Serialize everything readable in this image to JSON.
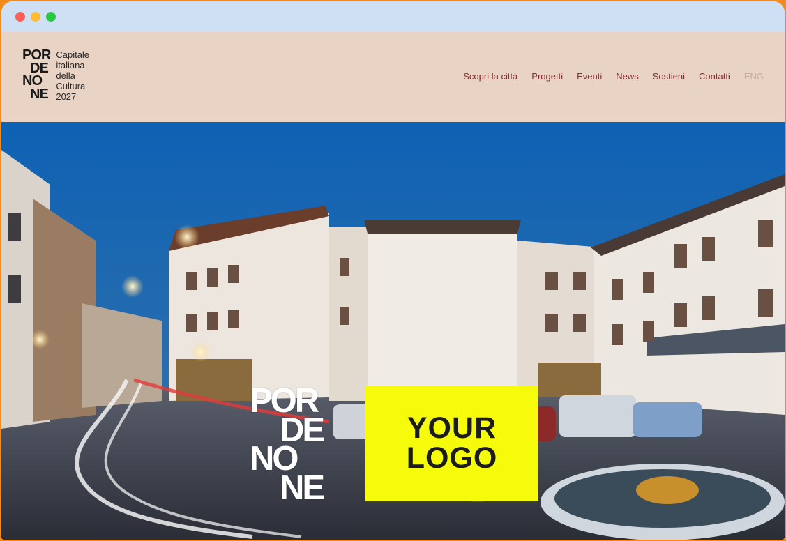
{
  "window": {
    "controls": [
      "close",
      "minimize",
      "maximize"
    ],
    "colors": {
      "frame": "#f28a1d",
      "titlebar": "#cfe0f5",
      "close": "#fe5f57",
      "minimize": "#febc2e",
      "maximize": "#28c840"
    }
  },
  "header": {
    "brand": {
      "mark_lines": [
        "POR",
        "DE",
        "NO",
        "NE"
      ],
      "text_lines": [
        "Capitale",
        "italiana",
        "della",
        "Cultura",
        "2027"
      ]
    },
    "nav": [
      "Scopri la città",
      "Progetti",
      "Eventi",
      "News",
      "Sostieni",
      "Contatti",
      "ENG"
    ],
    "colors": {
      "background": "#e8d3c4",
      "nav_text": "#8a2c2c",
      "lang_text": "#c9a8a6"
    }
  },
  "hero": {
    "image_description_icon": "town-square-night-photo",
    "overlay_mark_lines": [
      "POR",
      "DE",
      "NO",
      "NE"
    ],
    "logo_placeholder": {
      "lines": [
        "YOUR",
        "LOGO"
      ],
      "background": "#f5fb0a"
    }
  }
}
